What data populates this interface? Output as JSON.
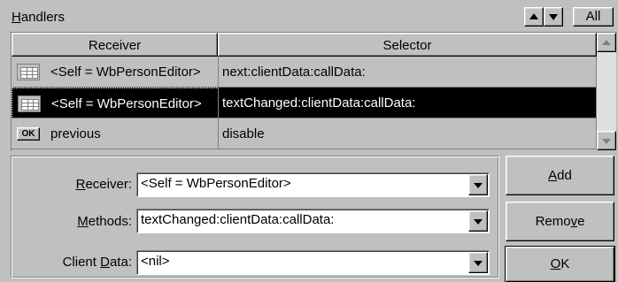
{
  "handlers": {
    "title_prefix": "H",
    "title_rest": "andlers",
    "all_label": "All"
  },
  "table": {
    "columns": [
      "Receiver",
      "Selector"
    ],
    "rows": [
      {
        "icon": "grid-icon",
        "receiver": "<Self = WbPersonEditor>",
        "selector": "next:clientData:callData:",
        "selected": false
      },
      {
        "icon": "grid-icon",
        "receiver": "<Self = WbPersonEditor>",
        "selector": "textChanged:clientData:callData:",
        "selected": true
      },
      {
        "icon": "ok-button-icon",
        "icon_text": "OK",
        "receiver": "previous",
        "selector": "disable",
        "selected": false
      }
    ]
  },
  "form": {
    "receiver_label_mnemonic": "R",
    "receiver_label_rest": "eceiver:",
    "receiver_value": "<Self = WbPersonEditor>",
    "methods_label_mnemonic": "M",
    "methods_label_rest": "ethods:",
    "methods_value": "textChanged:clientData:callData:",
    "client_label_pre": "Client ",
    "client_label_mnemonic": "D",
    "client_label_rest": "ata:",
    "client_value": "<nil>"
  },
  "buttons": {
    "add_mnemonic": "A",
    "add_rest": "dd",
    "remove_pre": "Remo",
    "remove_mnemonic": "v",
    "remove_rest": "e",
    "ok_mnemonic": "O",
    "ok_rest": "K"
  },
  "colors": {
    "face": "#c0c0c0",
    "selection": "#000000",
    "selection_text": "#ffffff"
  }
}
